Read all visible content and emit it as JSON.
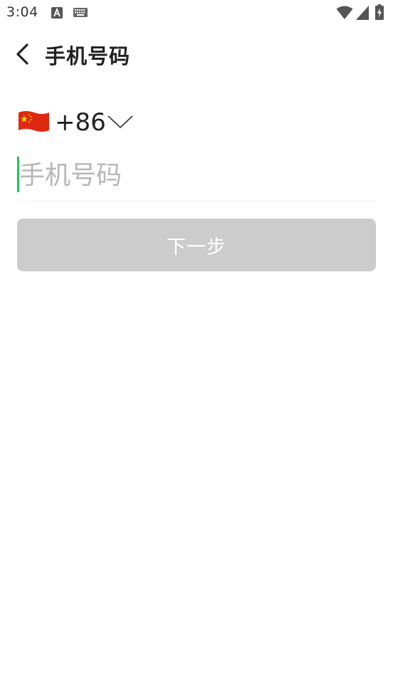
{
  "status_bar": {
    "time": "3:04",
    "icons": [
      "a-badge-icon",
      "keyboard-icon",
      "wifi-icon",
      "cell-signal-icon",
      "battery-charging-icon"
    ]
  },
  "toolbar": {
    "back_icon": "chevron-left-icon",
    "title": "手机号码"
  },
  "country": {
    "flag": "china-flag-icon",
    "code": "+86",
    "dropdown_icon": "chevron-down-icon"
  },
  "phone": {
    "value": "",
    "placeholder": "手机号码"
  },
  "next_button": {
    "label": "下一步"
  },
  "colors": {
    "background": "#ffffff",
    "text": "#222222",
    "placeholder": "#b7b7b7",
    "caret": "#21c161",
    "button_disabled": "#cccccc",
    "button_text": "#ffffff",
    "flag_red": "#de2910",
    "flag_yellow": "#ffde00"
  }
}
